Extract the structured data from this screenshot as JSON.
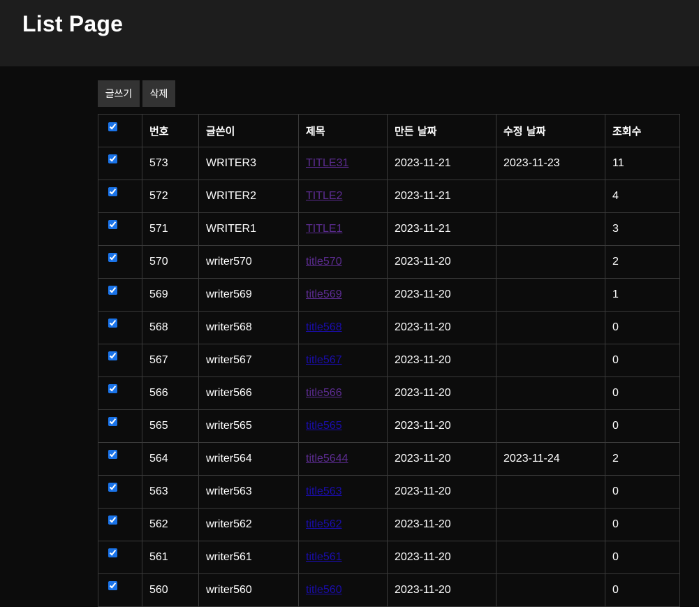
{
  "page": {
    "title": "List Page"
  },
  "toolbar": {
    "write_label": "글쓰기",
    "delete_label": "삭제"
  },
  "table": {
    "headers": {
      "number": "번호",
      "writer": "글쓴이",
      "title": "제목",
      "created": "만든 날짜",
      "updated": "수정 날짜",
      "views": "조회수"
    },
    "header_checked": true,
    "rows": [
      {
        "checked": true,
        "number": "573",
        "writer": "WRITER3",
        "title": "TITLE31",
        "visited": true,
        "created": "2023-11-21",
        "updated": "2023-11-23",
        "views": "11"
      },
      {
        "checked": true,
        "number": "572",
        "writer": "WRITER2",
        "title": "TITLE2",
        "visited": true,
        "created": "2023-11-21",
        "updated": "",
        "views": "4"
      },
      {
        "checked": true,
        "number": "571",
        "writer": "WRITER1",
        "title": "TITLE1",
        "visited": true,
        "created": "2023-11-21",
        "updated": "",
        "views": "3"
      },
      {
        "checked": true,
        "number": "570",
        "writer": "writer570",
        "title": "title570",
        "visited": true,
        "created": "2023-11-20",
        "updated": "",
        "views": "2"
      },
      {
        "checked": true,
        "number": "569",
        "writer": "writer569",
        "title": "title569",
        "visited": true,
        "created": "2023-11-20",
        "updated": "",
        "views": "1"
      },
      {
        "checked": true,
        "number": "568",
        "writer": "writer568",
        "title": "title568",
        "visited": false,
        "created": "2023-11-20",
        "updated": "",
        "views": "0"
      },
      {
        "checked": true,
        "number": "567",
        "writer": "writer567",
        "title": "title567",
        "visited": false,
        "created": "2023-11-20",
        "updated": "",
        "views": "0"
      },
      {
        "checked": true,
        "number": "566",
        "writer": "writer566",
        "title": "title566",
        "visited": true,
        "created": "2023-11-20",
        "updated": "",
        "views": "0"
      },
      {
        "checked": true,
        "number": "565",
        "writer": "writer565",
        "title": "title565",
        "visited": false,
        "created": "2023-11-20",
        "updated": "",
        "views": "0"
      },
      {
        "checked": true,
        "number": "564",
        "writer": "writer564",
        "title": "title5644",
        "visited": true,
        "created": "2023-11-20",
        "updated": "2023-11-24",
        "views": "2"
      },
      {
        "checked": true,
        "number": "563",
        "writer": "writer563",
        "title": "title563",
        "visited": false,
        "created": "2023-11-20",
        "updated": "",
        "views": "0"
      },
      {
        "checked": true,
        "number": "562",
        "writer": "writer562",
        "title": "title562",
        "visited": false,
        "created": "2023-11-20",
        "updated": "",
        "views": "0"
      },
      {
        "checked": true,
        "number": "561",
        "writer": "writer561",
        "title": "title561",
        "visited": false,
        "created": "2023-11-20",
        "updated": "",
        "views": "0"
      },
      {
        "checked": true,
        "number": "560",
        "writer": "writer560",
        "title": "title560",
        "visited": false,
        "created": "2023-11-20",
        "updated": "",
        "views": "0"
      }
    ]
  },
  "colors": {
    "link": "#1a0dab",
    "link_visited": "#5c2c91",
    "header_bg": "#1d1d1d",
    "page_bg": "#0c0c0c",
    "button_bg": "#333333"
  }
}
